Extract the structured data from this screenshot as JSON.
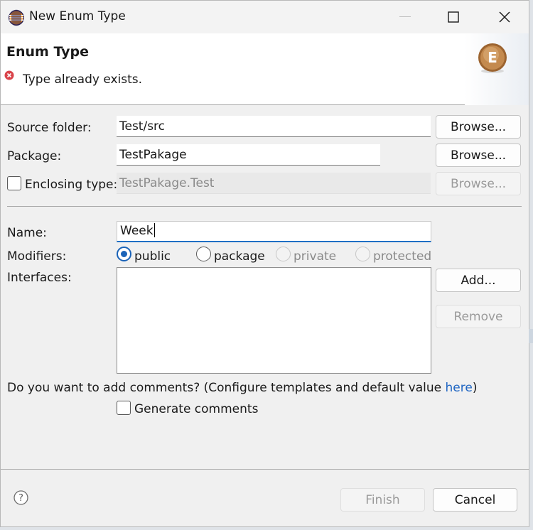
{
  "window": {
    "title": "New Enum Type"
  },
  "banner": {
    "title": "Enum Type",
    "message": "Type already exists.",
    "logo_letter": "E"
  },
  "source_folder": {
    "label": "Source folder:",
    "value": "Test/src",
    "browse": "Browse..."
  },
  "package": {
    "label": "Package:",
    "value": "TestPakage",
    "browse": "Browse..."
  },
  "enclosing": {
    "label": "Enclosing type:",
    "value": "TestPakage.Test",
    "browse": "Browse...",
    "checked": false
  },
  "name": {
    "label": "Name:",
    "value": "Week"
  },
  "modifiers": {
    "label": "Modifiers:",
    "options": [
      {
        "label": "public",
        "selected": true,
        "enabled": true
      },
      {
        "label": "package",
        "selected": false,
        "enabled": true
      },
      {
        "label": "private",
        "selected": false,
        "enabled": false
      },
      {
        "label": "protected",
        "selected": false,
        "enabled": false
      }
    ]
  },
  "interfaces": {
    "label": "Interfaces:",
    "add": "Add...",
    "remove": "Remove"
  },
  "comments": {
    "question_prefix": "Do you want to add comments? (Configure templates and default value ",
    "link": "here",
    "question_suffix": ")",
    "generate": "Generate comments",
    "checked": false
  },
  "footer": {
    "finish": "Finish",
    "cancel": "Cancel"
  },
  "colors": {
    "accent": "#1a63b8",
    "link": "#1f65c2",
    "error": "#d9434a",
    "logo": "#b27a3e"
  }
}
